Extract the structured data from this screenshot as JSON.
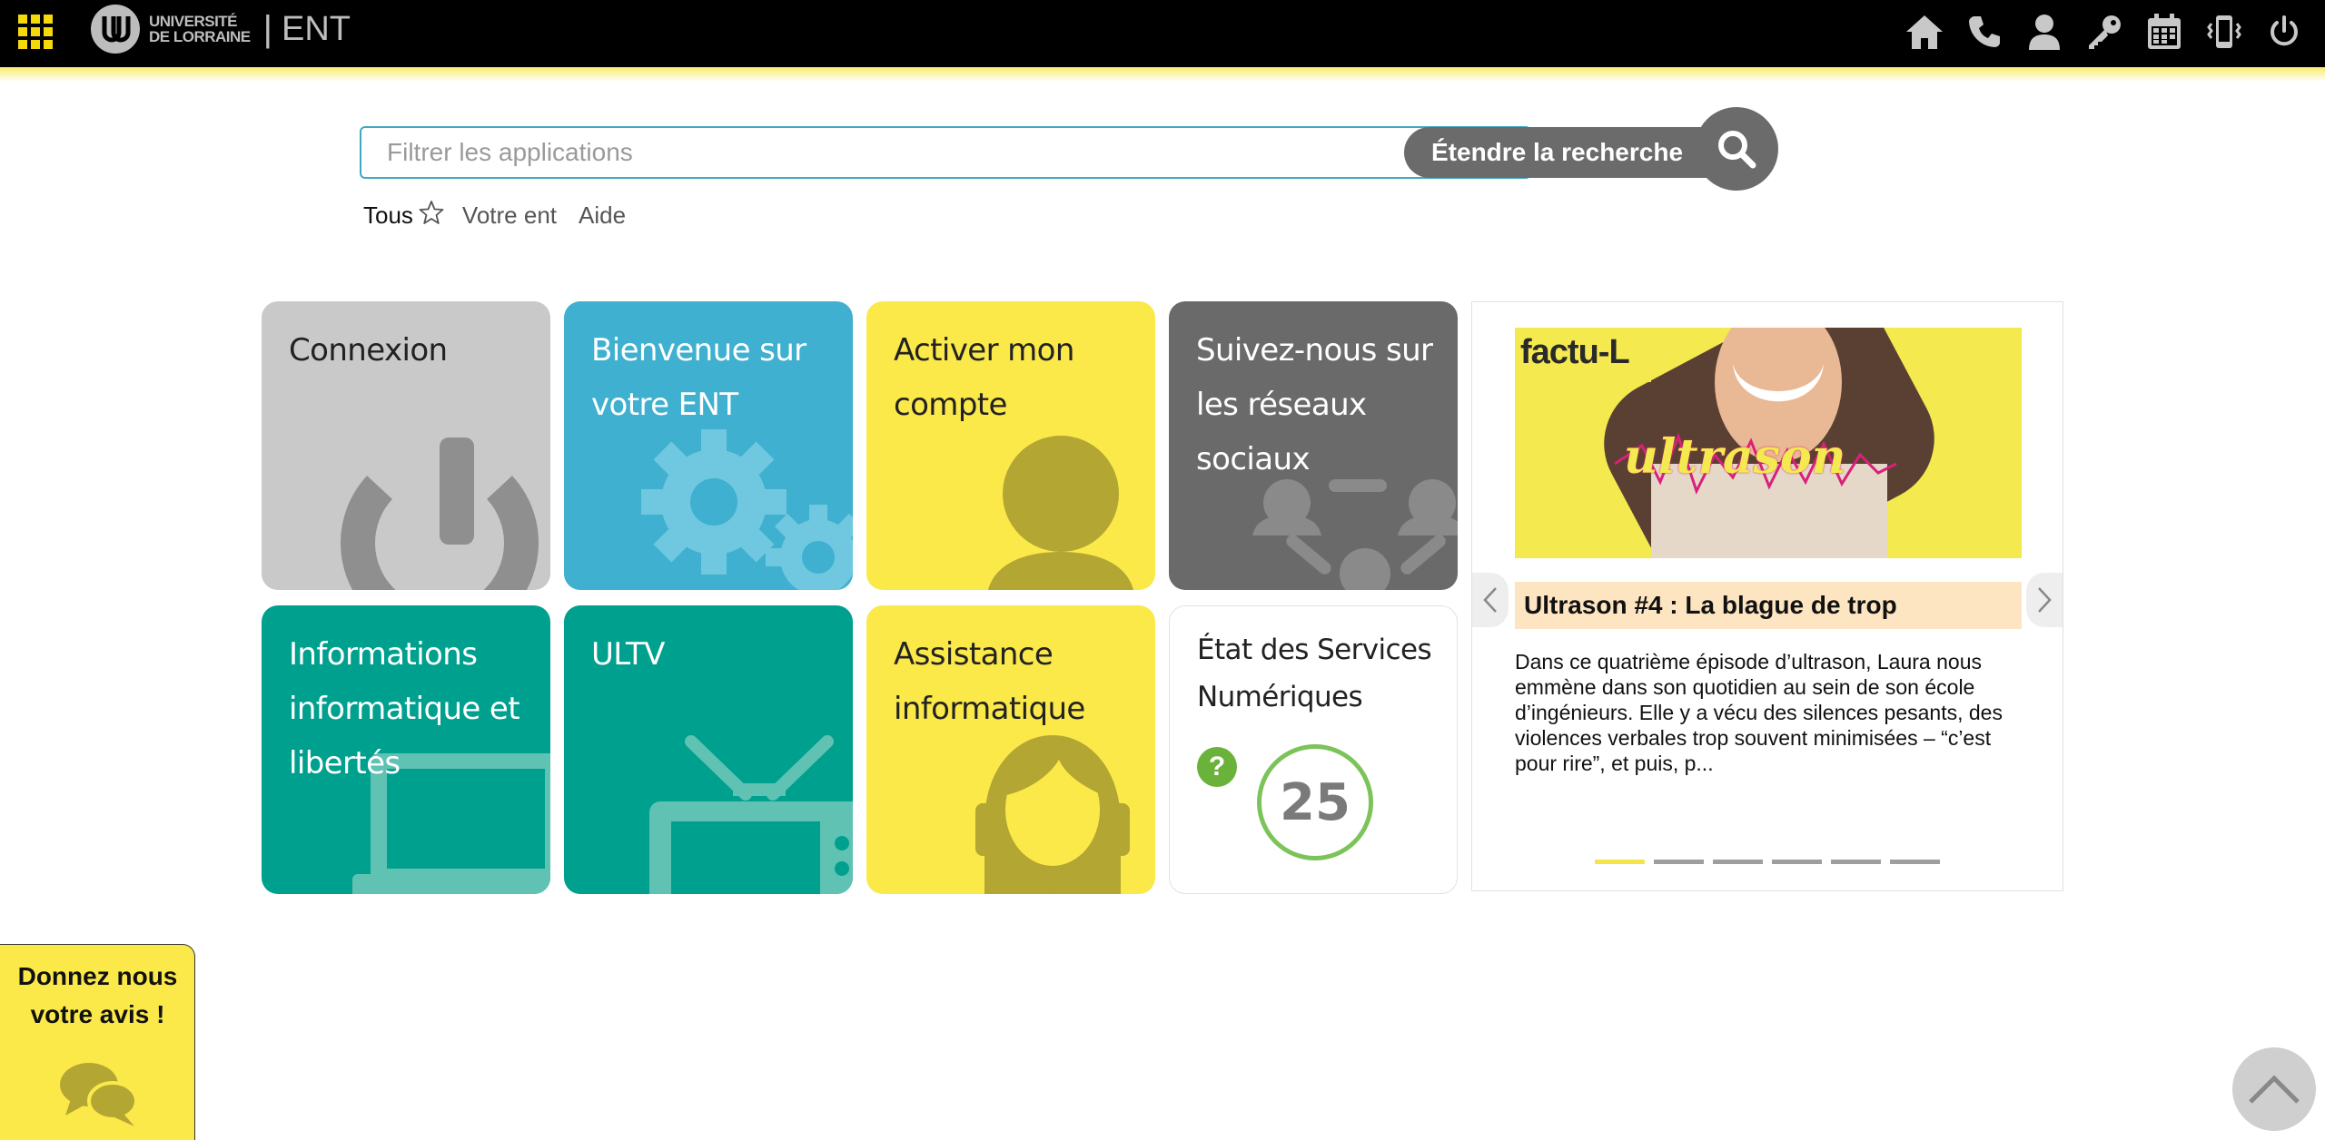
{
  "header": {
    "logo_line1": "UNIVERSITÉ",
    "logo_line2": "DE LORRAINE",
    "separator": "|",
    "app_name": "ENT",
    "icons": [
      "apps-grid-icon",
      "home-icon",
      "phone-icon",
      "user-icon",
      "key-icon",
      "calendar-icon",
      "mobile-vibrate-icon",
      "power-icon"
    ]
  },
  "search": {
    "placeholder": "Filtrer les applications",
    "extend_label": "Étendre la recherche"
  },
  "filters": {
    "all": "Tous",
    "your_ent": "Votre ent",
    "help": "Aide"
  },
  "tiles": {
    "connexion": "Connexion",
    "bienvenue": "Bienvenue sur votre ENT",
    "activer": "Activer mon compte",
    "suivez": "Suivez-nous sur les réseaux sociaux",
    "informations": "Informations informatique et libertés",
    "ultv": "ULTV",
    "assistance": "Assistance informatique",
    "etat": "État des Services Numériques",
    "etat_count": "25",
    "etat_help": "?"
  },
  "news": {
    "image_brand": "factu-L",
    "image_word": "ultrason",
    "title": "Ultrason #4 : La blague de trop",
    "text": "Dans ce quatrième épisode d’ultrason, Laura nous emmène dans son quotidien au sein de son école d’ingénieurs. Elle y a vécu des silences pesants, des violences verbales trop souvent minimisées – “c’est pour rire”, et puis, p...",
    "dots_total": 6,
    "active_dot": 1
  },
  "feedback": {
    "line1": "Donnez nous",
    "line2": "votre avis !"
  },
  "colors": {
    "topbar": "#000000",
    "accent_yellow": "#fbe94a",
    "tile_blue": "#3fb0cf",
    "tile_teal": "#00a08e",
    "tile_gray": "#c9c9c9",
    "tile_dark_gray": "#6a6a6a",
    "status_green": "#7cc35a"
  }
}
